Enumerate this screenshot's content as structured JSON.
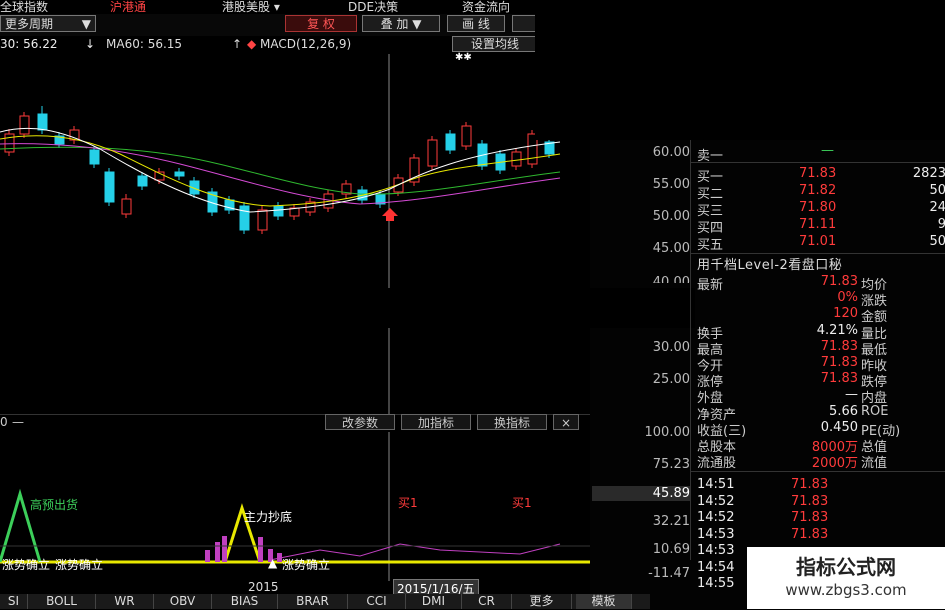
{
  "topbar": {
    "items": [
      "全球指数",
      "沪港通",
      "港股美股 ▾",
      "DDE决策",
      "资金流向"
    ]
  },
  "toolbar": {
    "period": "更多周期",
    "fuquan": "复 权",
    "overlay": "叠 加",
    "draw": "画 线"
  },
  "ma": {
    "ma30": "30: 56.22",
    "ma60": "MA60: 56.15",
    "macd": "MACD(12,26,9)",
    "set_button": "设置均线"
  },
  "main_axis": [
    "60.00",
    "55.00",
    "50.00",
    "45.00",
    "40.00",
    "30.00",
    "25.00"
  ],
  "sub_axis": [
    "100.00",
    "75.23",
    "45.89",
    "32.21",
    "10.69",
    "-11.47"
  ],
  "subchart": {
    "zero": "0",
    "buttons": [
      "改参数",
      "加指标",
      "换指标",
      "×"
    ],
    "annotations": [
      "高预出货",
      "主力抄底",
      "买1",
      "买1",
      "涨势确立",
      "涨势确立",
      "涨势确立"
    ]
  },
  "date_axis": {
    "year": "2015",
    "date": "2015/1/16/五"
  },
  "quote": {
    "sell1": {
      "label": "卖一",
      "price": "—",
      "vol": ""
    },
    "buys": [
      {
        "label": "买一",
        "price": "71.83",
        "vol": "2823"
      },
      {
        "label": "买二",
        "price": "71.82",
        "vol": "50"
      },
      {
        "label": "买三",
        "price": "71.80",
        "vol": "24"
      },
      {
        "label": "买四",
        "price": "71.11",
        "vol": "9"
      },
      {
        "label": "买五",
        "price": "71.01",
        "vol": "50"
      }
    ],
    "level2": "用千档Level-2看盘口秘",
    "stats": [
      {
        "l": "最新",
        "v": "71.83",
        "l2": "均价"
      },
      {
        "l": "",
        "v": "0%",
        "l2": "涨跌"
      },
      {
        "l": "",
        "v": "120",
        "l2": "金额"
      },
      {
        "l": "换手",
        "v": "4.21%",
        "l2": "量比"
      },
      {
        "l": "最高",
        "v": "71.83",
        "l2": "最低"
      },
      {
        "l": "今开",
        "v": "71.83",
        "l2": "昨收"
      },
      {
        "l": "涨停",
        "v": "71.83",
        "l2": "跌停"
      },
      {
        "l": "外盘",
        "v": "—",
        "l2": "内盘"
      },
      {
        "l": "净资产",
        "v": "5.66",
        "l2": "ROE"
      },
      {
        "l": "收益(三)",
        "v": "0.450",
        "l2": "PE(动)"
      },
      {
        "l": "总股本",
        "v": "8000万",
        "l2": "总值"
      },
      {
        "l": "流通股",
        "v": "2000万",
        "l2": "流值"
      }
    ],
    "ticks": [
      {
        "t": "14:51",
        "p": "71.83"
      },
      {
        "t": "14:52",
        "p": "71.83"
      },
      {
        "t": "14:52",
        "p": "71.83"
      },
      {
        "t": "14:53",
        "p": "71.83"
      },
      {
        "t": "14:53",
        "p": ""
      },
      {
        "t": "14:54",
        "p": ""
      },
      {
        "t": "14:55",
        "p": ""
      }
    ]
  },
  "tabs": [
    "SI",
    "BOLL",
    "WR",
    "OBV",
    "BIAS",
    "BRAR",
    "CCI",
    "DMI",
    "CR",
    "更多",
    "模板"
  ],
  "watermark": {
    "title": "指标公式网",
    "url": "www.zbgs3.com"
  },
  "colors": {
    "up": "#ff3b3b",
    "down": "#25d0e8",
    "ma_white": "#ffffff",
    "ma_yellow": "#e8e800",
    "ma_purple": "#d44ad4",
    "ma_green": "#2fb82f"
  }
}
